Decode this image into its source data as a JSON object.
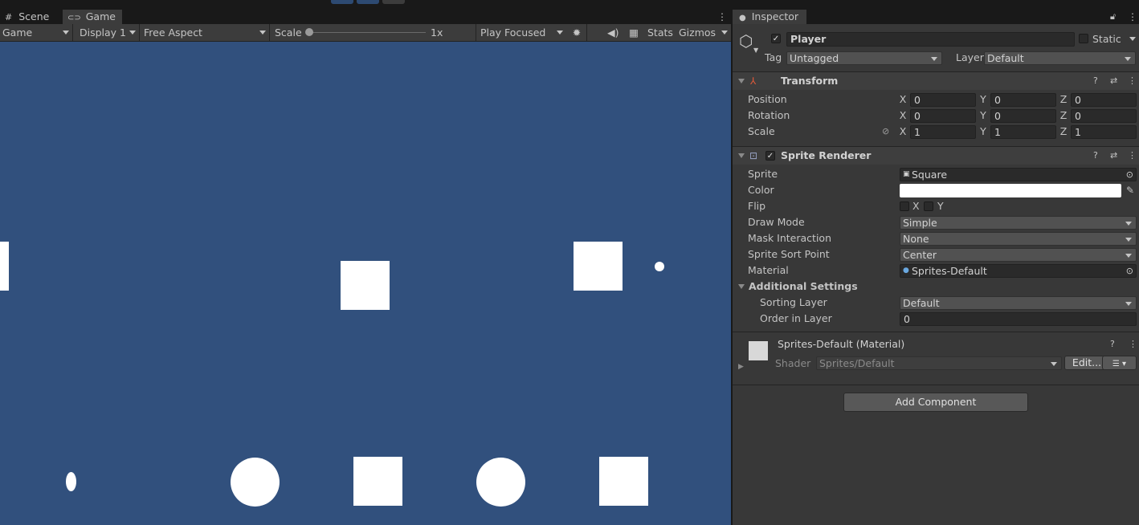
{
  "tabs": {
    "scene": "Scene",
    "game": "Game"
  },
  "game_toolbar": {
    "mode": "Game",
    "display": "Display 1",
    "aspect": "Free Aspect",
    "scale_label": "Scale",
    "scale_value": "1x",
    "play_mode": "Play Focused",
    "stats": "Stats",
    "gizmos": "Gizmos"
  },
  "viewport": {
    "background": "#31507d"
  },
  "inspector": {
    "tab": "Inspector",
    "object_name": "Player",
    "static_label": "Static",
    "tag_label": "Tag",
    "tag_value": "Untagged",
    "layer_label": "Layer",
    "layer_value": "Default",
    "transform": {
      "title": "Transform",
      "position_label": "Position",
      "rotation_label": "Rotation",
      "scale_label": "Scale",
      "position": {
        "x": "0",
        "y": "0",
        "z": "0"
      },
      "rotation": {
        "x": "0",
        "y": "0",
        "z": "0"
      },
      "scale": {
        "x": "1",
        "y": "1",
        "z": "1"
      },
      "axis_x": "X",
      "axis_y": "Y",
      "axis_z": "Z"
    },
    "sprite_renderer": {
      "title": "Sprite Renderer",
      "sprite_label": "Sprite",
      "sprite_value": "Square",
      "color_label": "Color",
      "color_value": "#ffffff",
      "flip_label": "Flip",
      "flip_x": "X",
      "flip_y": "Y",
      "draw_mode_label": "Draw Mode",
      "draw_mode_value": "Simple",
      "mask_label": "Mask Interaction",
      "mask_value": "None",
      "sort_point_label": "Sprite Sort Point",
      "sort_point_value": "Center",
      "material_label": "Material",
      "material_value": "Sprites-Default",
      "additional_label": "Additional Settings",
      "sorting_layer_label": "Sorting Layer",
      "sorting_layer_value": "Default",
      "order_label": "Order in Layer",
      "order_value": "0"
    },
    "material": {
      "title": "Sprites-Default (Material)",
      "shader_label": "Shader",
      "shader_value": "Sprites/Default",
      "edit_button": "Edit..."
    },
    "add_component": "Add Component"
  }
}
